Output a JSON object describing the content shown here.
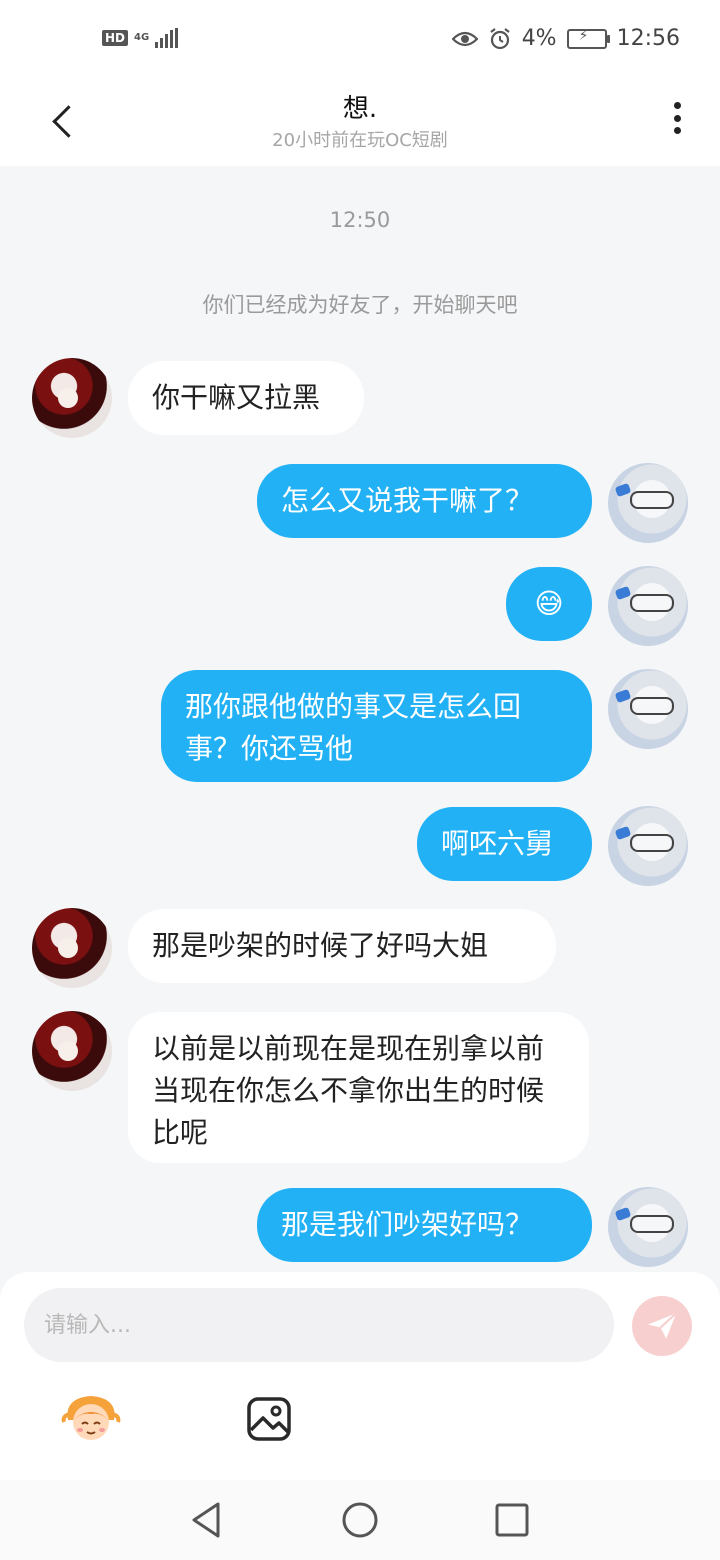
{
  "status_bar": {
    "hd": "HD",
    "network": "4G",
    "battery": "4%",
    "time": "12:56"
  },
  "header": {
    "title": "想.",
    "subtitle": "20小时前在玩OC短剧"
  },
  "chat": {
    "timestamp": "12:50",
    "system_notice": "你们已经成为好友了，开始聊天吧",
    "messages": [
      {
        "side": "other",
        "text": "你干嘛又拉黑"
      },
      {
        "side": "me",
        "text": "怎么又说我干嘛了？"
      },
      {
        "side": "me",
        "text": "😅"
      },
      {
        "side": "me",
        "text": "那你跟他做的事又是怎么回事？你还骂他"
      },
      {
        "side": "me",
        "text": "啊呸六舅"
      },
      {
        "side": "other",
        "text": "那是吵架的时候了好吗大姐"
      },
      {
        "side": "other",
        "text": "以前是以前现在是现在别拿以前当现在你怎么不拿你出生的时候比呢"
      },
      {
        "side": "me",
        "text": "那是我们吵架好吗？"
      }
    ]
  },
  "input": {
    "placeholder": "请输入..."
  },
  "colors": {
    "my_bubble": "#22b1f5",
    "other_bubble": "#ffffff",
    "send_button": "#f8cfcf",
    "background": "#f5f6f8"
  },
  "icons": {
    "back": "chevron-left-icon",
    "more": "more-vertical-icon",
    "send": "send-icon",
    "emoji": "character-emoji-icon",
    "image": "image-icon",
    "nav_back": "triangle-back-icon",
    "nav_home": "circle-home-icon",
    "nav_recent": "square-recent-icon"
  }
}
